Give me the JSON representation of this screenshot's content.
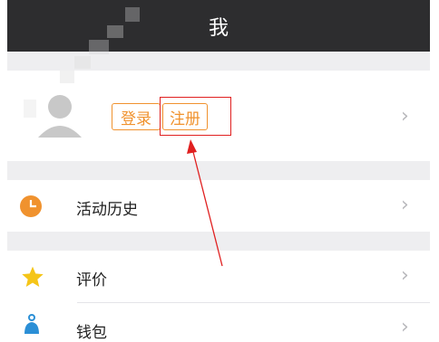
{
  "header": {
    "title": "我"
  },
  "profile": {
    "login_label": "登录",
    "register_label": "注册"
  },
  "menu": [
    {
      "label": "活动历史",
      "icon": "clock-icon"
    },
    {
      "label": "评价",
      "icon": "star-icon"
    },
    {
      "label": "钱包",
      "icon": "wallet-icon"
    }
  ],
  "colors": {
    "header_bg": "#2d2d2f",
    "accent": "#f0922e",
    "annotation": "#e02020",
    "star": "#f5c518",
    "wallet": "#2b8fd6"
  }
}
